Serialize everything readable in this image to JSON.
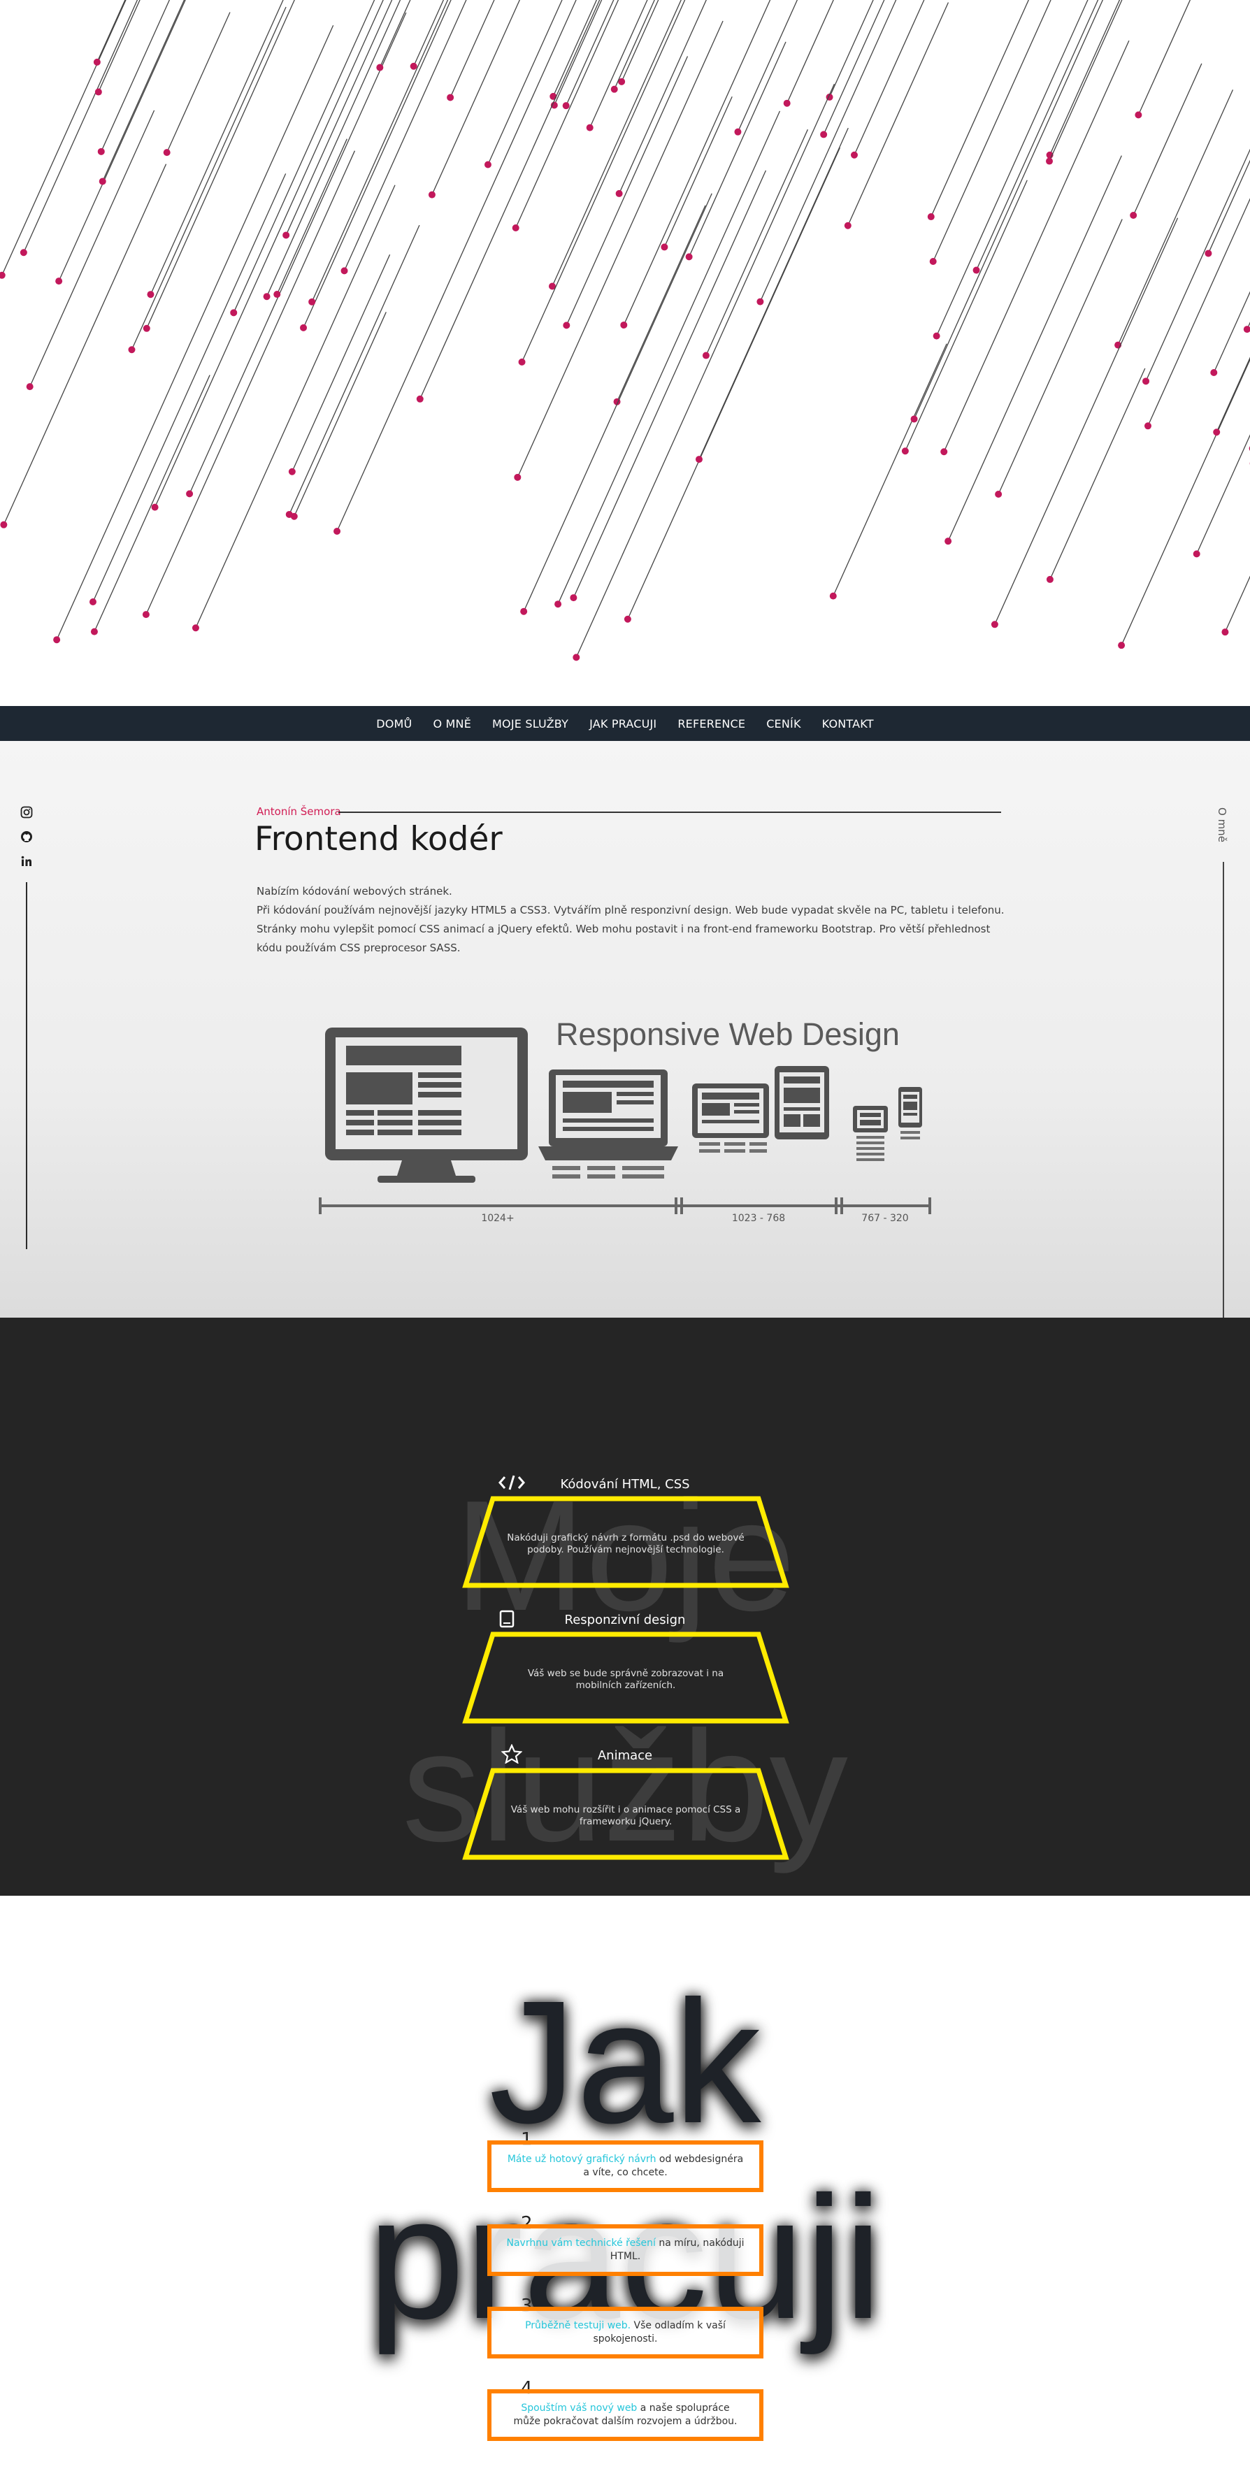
{
  "nav": {
    "items": [
      "DOMŮ",
      "O MNĚ",
      "MOJE SLUŽBY",
      "JAK PRACUJI",
      "REFERENCE",
      "CENÍK",
      "KONTAKT"
    ]
  },
  "about": {
    "name": "Antonín Šemora",
    "title": "Frontend kodér",
    "side_label": "O mně",
    "intro": [
      "Nabízím kódování webových stránek.",
      "Při kódování používám nejnovější jazyky HTML5 a CSS3. Vytvářím plně responzivní design. Web bude vypadat skvěle na PC, tabletu i telefonu.",
      "Stránky mohu vylepšit pomocí CSS animací a jQuery efektů. Web mohu postavit i na front-end frameworku Bootstrap. Pro větší přehlednost kódu používám CSS preprocesor SASS."
    ],
    "rwd": {
      "heading": "Responsive Web Design",
      "ranges": [
        "1024+",
        "1023 - 768",
        "767 - 320"
      ]
    },
    "social": [
      "instagram-icon",
      "github-icon",
      "linkedin-icon"
    ]
  },
  "services": {
    "background_text": [
      "Moje",
      "služby"
    ],
    "items": [
      {
        "icon": "code-icon",
        "title": "Kódování HTML, CSS",
        "text": "Nakóduji grafický návrh z formátu .psd do webové podoby. Používám nejnovější technologie."
      },
      {
        "icon": "tablet-icon",
        "title": "Responzivní design",
        "text": "Váš web se bude správně zobrazovat i na mobilních zařízeních."
      },
      {
        "icon": "star-icon",
        "title": "Animace",
        "text": "Váš web mohu rozšířit i o animace pomocí CSS a frameworku jQuery."
      }
    ],
    "colors": {
      "accent": "#ffeb00",
      "background": "#252525"
    }
  },
  "process": {
    "background_text": [
      "Jak",
      "pracuji"
    ],
    "steps": [
      {
        "number": "1",
        "highlight": "Máte už hotový grafický návrh",
        "rest": " od webdesignéra a víte, co chcete."
      },
      {
        "number": "2",
        "highlight": "Navrhnu vám technické řešení",
        "rest": " na míru, nakóduji HTML."
      },
      {
        "number": "3",
        "highlight": "Průběžně testuji web.",
        "rest": " Vše odladím k vaší spokojenosti."
      },
      {
        "number": "4",
        "highlight": "Spouštím váš nový web",
        "rest": " a naše spolupráce může pokračovat dalším rozvojem a údržbou."
      }
    ],
    "colors": {
      "border": "#ff8000",
      "highlight": "#26c6da"
    }
  },
  "colors": {
    "nav": "#1e2833",
    "accent_pink": "#c2185b"
  }
}
